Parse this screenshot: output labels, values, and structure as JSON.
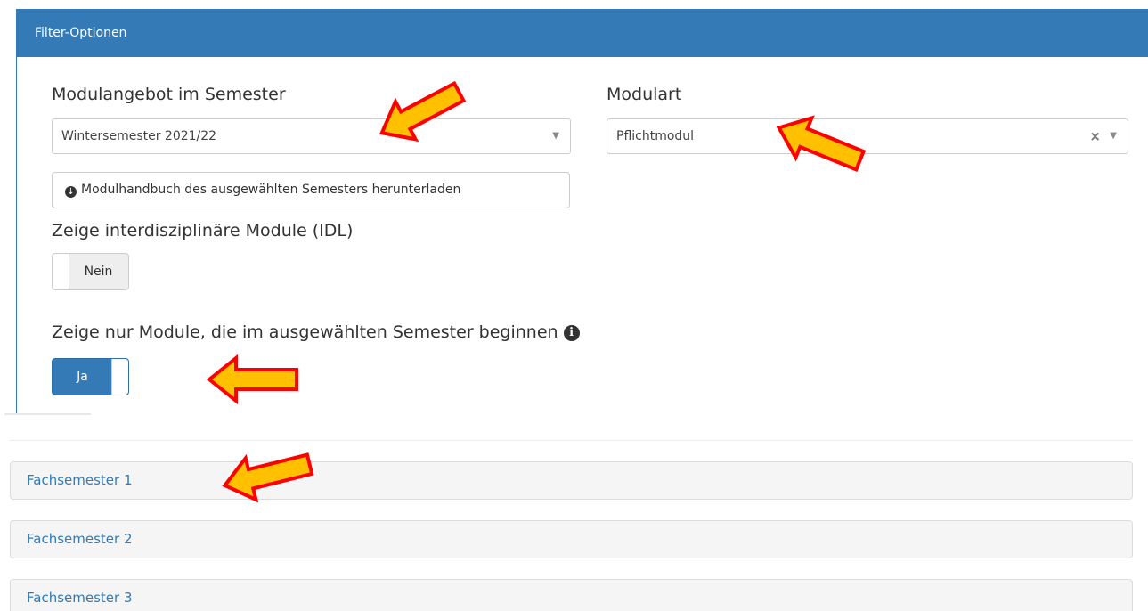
{
  "panel": {
    "title": "Filter-Optionen"
  },
  "semester_filter": {
    "label": "Modulangebot im Semester",
    "selected": "Wintersemester 2021/22",
    "caret": "▼"
  },
  "modulart_filter": {
    "label": "Modulart",
    "selected": "Pflichtmodul",
    "clear": "×",
    "caret": "▼"
  },
  "download_button": {
    "icon": "⊕",
    "label": "Modulhandbuch des ausgewählten Semesters herunterladen"
  },
  "idl_toggle": {
    "label": "Zeige interdisziplinäre Module (IDL)",
    "state": "Nein"
  },
  "begin_toggle": {
    "label": "Zeige nur Module, die im ausgewählten Semester beginnen",
    "info_icon": "i",
    "state": "Ja"
  },
  "accordion": {
    "items": [
      {
        "label": "Fachsemester 1"
      },
      {
        "label": "Fachsemester 2"
      },
      {
        "label": "Fachsemester 3"
      }
    ]
  },
  "colors": {
    "primary": "#337ab7",
    "arrow_fill": "#ffc000",
    "arrow_stroke": "#ff0000"
  }
}
